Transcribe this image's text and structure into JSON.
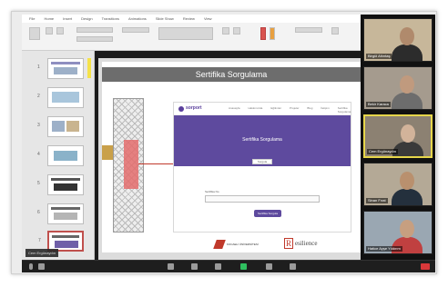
{
  "ribbon": {
    "tabs": [
      "File",
      "Home",
      "Insert",
      "Design",
      "Transitions",
      "Animations",
      "Slide Show",
      "Review",
      "View"
    ]
  },
  "slide": {
    "title": "Sertifika Sorgulama",
    "site": {
      "brand": "sorport",
      "nav": [
        "Anasayfa",
        "Hakkımızda",
        "Eğitimler",
        "Projeler",
        "Blog",
        "İletişim",
        "Sertifika Sorgulama"
      ],
      "hero_title": "Sertifika Sorgulama",
      "tab_label": "Sorgula",
      "input_label": "Sertifika No",
      "button_label": "Sertifika Sorgula"
    },
    "logos": {
      "university": "KOCAELİ ÜNİVERSİTESİ",
      "resilience_letter": "R",
      "resilience": "esilience"
    }
  },
  "speaker_chip": "Cem Ergünaydın",
  "participants": [
    {
      "name": "Birgül Altıntaş",
      "active": false,
      "bg": "#c7b79a",
      "skin": "#b08a6c",
      "shirt": "#2c2c2c"
    },
    {
      "name": "Bekir Karaca",
      "active": false,
      "bg": "#a59b8e",
      "skin": "#c09a7e",
      "shirt": "#6d6d6d"
    },
    {
      "name": "Cem Ergünaydın",
      "active": true,
      "bg": "#8c8172",
      "skin": "#d2b39a",
      "shirt": "#3a3a3a"
    },
    {
      "name": "Sinan Fırat",
      "active": false,
      "bg": "#b4a996",
      "skin": "#b9906e",
      "shirt": "#24303d"
    },
    {
      "name": "Hatice Ayşe Yıldırım",
      "active": false,
      "bg": "#9aa7b2",
      "skin": "#c79f80",
      "shirt": "#c04040"
    }
  ],
  "colors": {
    "accent": "#5e4a9e",
    "highlight": "#e36c6c",
    "end_call": "#d9383a",
    "share": "#2fbf5f"
  }
}
